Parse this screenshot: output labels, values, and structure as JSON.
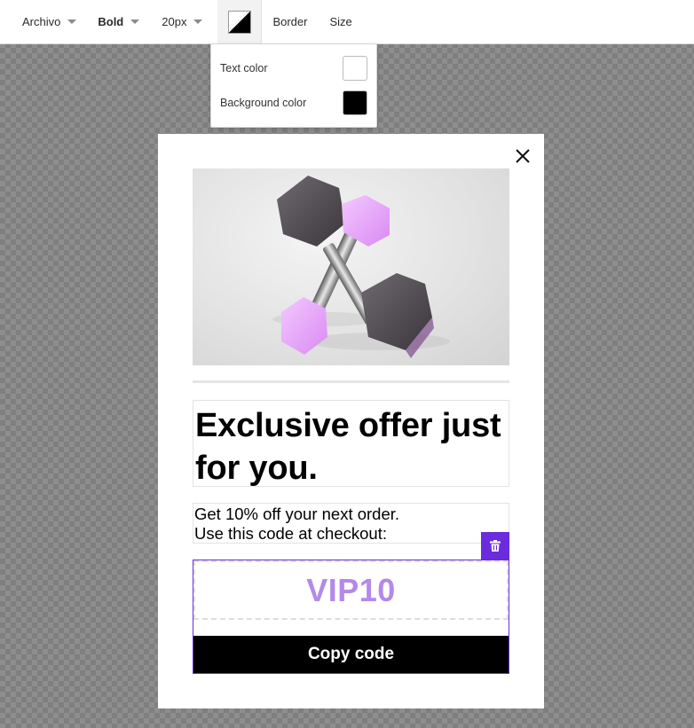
{
  "toolbar": {
    "font_family": "Archivo",
    "font_weight": "Bold",
    "font_size": "20px",
    "border_label": "Border",
    "size_label": "Size"
  },
  "color_menu": {
    "text_color_label": "Text color",
    "text_color_value": "#ffffff",
    "background_color_label": "Background color",
    "background_color_value": "#000000"
  },
  "popup": {
    "headline": "Exclusive offer just for you.",
    "subtext_line1": "Get 10% off your next order.",
    "subtext_line2": "Use this code at checkout:",
    "discount_code": "VIP10",
    "copy_button_label": "Copy code",
    "accent_color": "#6b2bde",
    "code_color": "#b489ea",
    "hero_image": "dumbbells-photo"
  },
  "icons": {
    "close": "close-icon",
    "delete": "trash-icon",
    "color_picker": "color-swatch-icon"
  }
}
